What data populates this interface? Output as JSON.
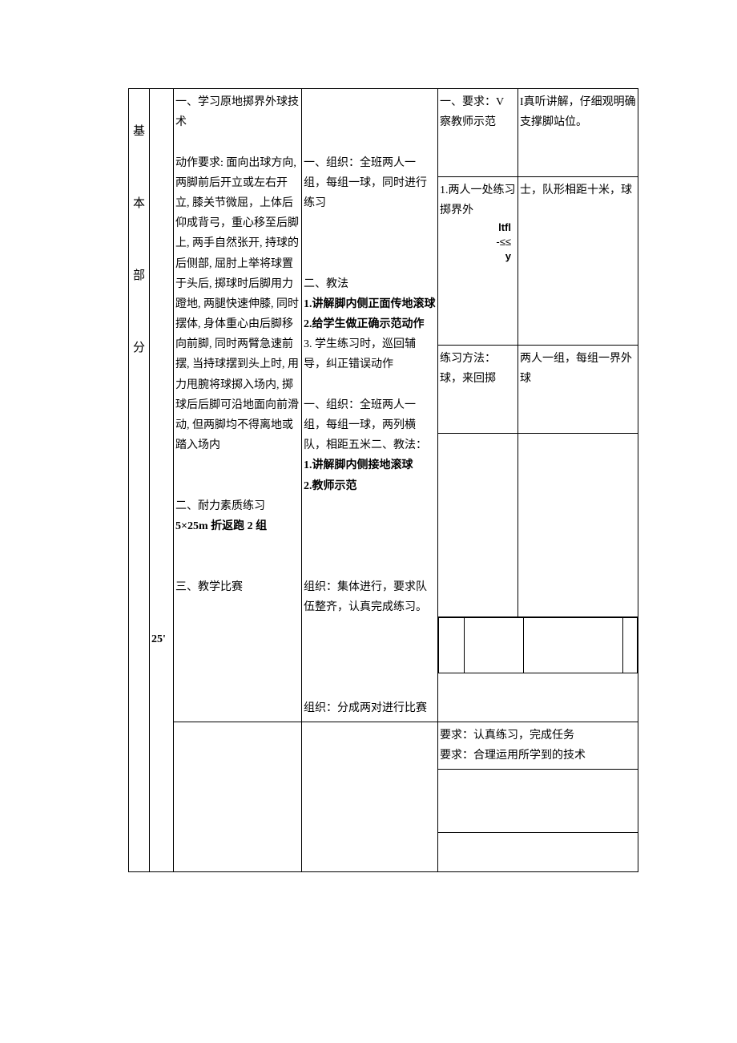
{
  "section": {
    "label_chars": [
      "基",
      "本",
      "部",
      "分"
    ],
    "time": "25'"
  },
  "content": {
    "item1_title": "一、学习原地掷界外球技术",
    "item1_req_label": "动作要求:",
    "item1_req_body": "面向出球方向, 两脚前后开立或左右开立, 膝关节微屈，上体后仰成背弓，重心移至后脚上, 两手自然张开, 持球的后侧部, 屈肘上举将球置于头后, 掷球时后脚用力蹬地, 两腿快速伸膝, 同时摆体, 身体重心由后脚移向前脚, 同时两臂急速前摆, 当持球摆到头上时, 用力甩腕将球掷入场内, 掷球后后脚可沿地面向前滑动, 但两脚均不得离地或踏入场内",
    "item2_title": "二、耐力素质练习",
    "item2_body": "5×25m 折返跑 2 组",
    "item3_title": "三、教学比赛"
  },
  "method": {
    "m1": "一、组织：全班两人一组，每组一球，同时进行练习",
    "m2_title": "二、教法",
    "m2_1": "1.讲解脚内侧正面传地滚球",
    "m2_2": "2.给学生做正确示范动作",
    "m2_3": "3. 学生练习时，巡回辅导，纠正错误动作",
    "m3": "一、组织：全班两人一组，每组一球，两列横队，相距五米二、教法：",
    "m3_1": "1.讲解脚内侧接地滚球",
    "m3_2": "2.教师示范",
    "m4": "组织：集体进行，要求队伍整齐，认真完成练习。",
    "m5": "组织：分成两对进行比赛"
  },
  "right": {
    "r1": "一、要求：V",
    "r1note": "察教师示范",
    "r2": "I真听讲解，仔细观明确支撑脚站位。",
    "pr1": "1.两人一处练习掷界外",
    "pr2": "士，队形相距十米，球",
    "dia_1": "ltfl",
    "dia_2": "-≤≤",
    "dia_3": "y",
    "pm_label": "练习方法：球，来回掷",
    "pm_r": "两人一组，每组一界外球",
    "req1": "要求：认真练习，完成任务",
    "req2": "要求：合理运用所学到的技术"
  }
}
